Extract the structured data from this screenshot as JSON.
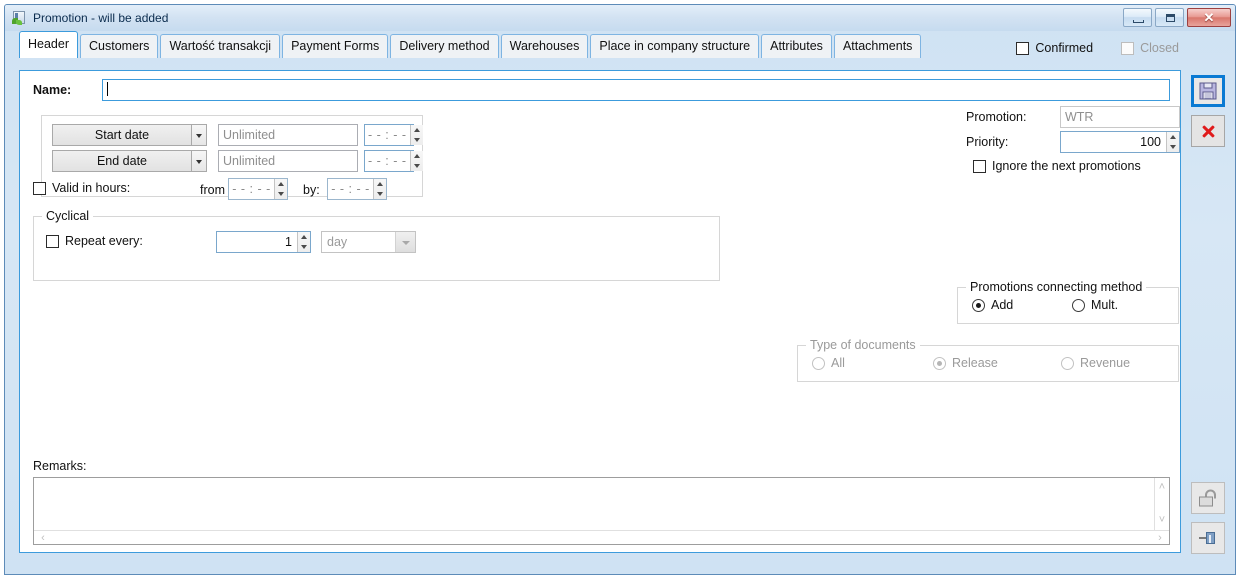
{
  "window": {
    "title": "Promotion - will be added",
    "icon": "app-window-icon",
    "controls": {
      "minimize": "–",
      "maximize": "□",
      "close": "✕"
    }
  },
  "tabs": [
    {
      "label": "Header",
      "active": true
    },
    {
      "label": "Customers",
      "active": false
    },
    {
      "label": "Wartość transakcji",
      "active": false
    },
    {
      "label": "Payment Forms",
      "active": false
    },
    {
      "label": "Delivery method",
      "active": false
    },
    {
      "label": "Warehouses",
      "active": false
    },
    {
      "label": "Place in company structure",
      "active": false
    },
    {
      "label": "Attributes",
      "active": false
    },
    {
      "label": "Attachments",
      "active": false
    }
  ],
  "header_flags": {
    "confirmed_label": "Confirmed",
    "closed_label": "Closed"
  },
  "form": {
    "name_label": "Name:",
    "name_value": "",
    "start_date_button": "Start date",
    "start_date_value": "Unlimited",
    "start_time_value": "- - : - -",
    "end_date_button": "End date",
    "end_date_value": "Unlimited",
    "end_time_value": "- - : - -",
    "valid_in_hours_label": "Valid in hours:",
    "from_label": "from",
    "from_time_value": "- - : - -",
    "by_label": "by:",
    "by_time_value": "- - : - -"
  },
  "cyclical": {
    "title": "Cyclical",
    "repeat_every_label": "Repeat every:",
    "repeat_value": "1",
    "unit_value": "day"
  },
  "promotion": {
    "promotion_label": "Promotion:",
    "promotion_value": "WTR",
    "priority_label": "Priority:",
    "priority_value": "100",
    "ignore_next_label": "Ignore the next promotions"
  },
  "connecting_method": {
    "title": "Promotions connecting method",
    "options": [
      {
        "label": "Add",
        "selected": true
      },
      {
        "label": "Mult.",
        "selected": false
      }
    ]
  },
  "type_of_documents": {
    "title": "Type of documents",
    "disabled": true,
    "options": [
      {
        "label": "All",
        "selected": false
      },
      {
        "label": "Release",
        "selected": true
      },
      {
        "label": "Revenue",
        "selected": false
      }
    ]
  },
  "remarks": {
    "label": "Remarks:",
    "value": ""
  },
  "toolbar": {
    "save": "save-icon",
    "cancel": "cancel-icon",
    "unlock": "unlock-icon",
    "pin": "pin-icon"
  },
  "scrollbars": {
    "up": "˄",
    "down": "˅",
    "left": "‹",
    "right": "›"
  }
}
